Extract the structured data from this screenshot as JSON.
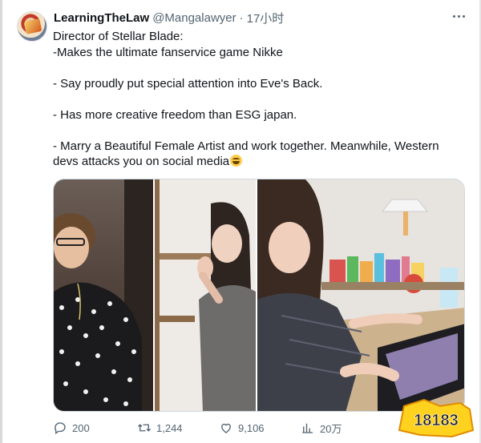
{
  "tweet": {
    "author_name": "LearningTheLaw",
    "author_handle": "@Mangalawyer",
    "separator": "·",
    "timestamp": "17小时",
    "lines": [
      "Director of Stellar Blade:",
      "-Makes the ultimate fanservice game Nikke",
      "",
      "- Say proudly put special attention into Eve's Back.",
      "",
      "- Has more creative freedom than ESG japan.",
      "",
      "- Marry a Beautiful Female Artist and work together. Meanwhile, Western",
      "devs attacks you on social media"
    ],
    "emoji_icon": "grinning-squinting-face-emoji"
  },
  "actions": {
    "reply_count": "200",
    "retweet_count": "1,244",
    "like_count": "9,106",
    "views_count": "20万"
  },
  "watermark_text": "18183",
  "colors": {
    "text": "#0f1419",
    "secondary": "#536471",
    "border": "#cfd9de"
  }
}
